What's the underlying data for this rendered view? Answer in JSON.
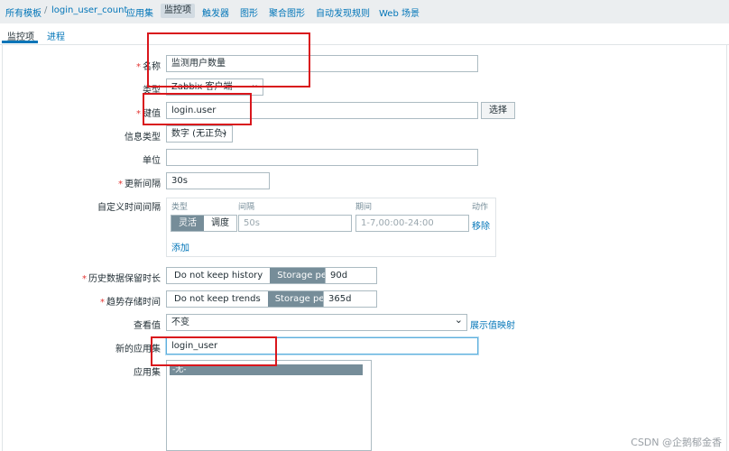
{
  "breadcrumb": {
    "items": [
      "所有模板",
      "login_user_count",
      "应用集",
      "监控项",
      "触发器",
      "图形",
      "聚合图形",
      "自动发现规则",
      "Web 场景"
    ]
  },
  "tabs": [
    "监控项",
    "进程"
  ],
  "form": {
    "name": {
      "label": "名称",
      "value": "监测用户数量"
    },
    "type": {
      "label": "类型",
      "value": "Zabbix 客户端"
    },
    "key": {
      "label": "键值",
      "value": "login.user",
      "button": "选择"
    },
    "info_type": {
      "label": "信息类型",
      "value": "数字 (无正负)"
    },
    "unit": {
      "label": "单位",
      "value": ""
    },
    "update_interval": {
      "label": "更新间隔",
      "value": "30s"
    },
    "custom_intervals": {
      "label": "自定义时间间隔",
      "headers": {
        "type": "类型",
        "interval": "间隔",
        "period": "期间",
        "action": "动作"
      },
      "type_options": [
        "灵活",
        "调度"
      ],
      "selected_type": "灵活",
      "interval_placeholder": "50s",
      "period_placeholder": "1-7,00:00-24:00",
      "remove": "移除",
      "add": "添加"
    },
    "history": {
      "label": "历史数据保留时长",
      "options": [
        "Do not keep history",
        "Storage period"
      ],
      "selected": "Storage period",
      "value": "90d"
    },
    "trends": {
      "label": "趋势存储时间",
      "options": [
        "Do not keep trends",
        "Storage period"
      ],
      "selected": "Storage period",
      "value": "365d"
    },
    "show_value": {
      "label": "查看值",
      "value": "不变",
      "mapping_link": "展示值映射"
    },
    "new_app": {
      "label": "新的应用集",
      "value": "login_user"
    },
    "apps": {
      "label": "应用集",
      "selected": "-无-"
    }
  },
  "watermark": "CSDN @企鹅郁金香",
  "colors": {
    "highlight": "#d9161c",
    "link": "#0275b8",
    "selected_segment": "#768d99"
  }
}
